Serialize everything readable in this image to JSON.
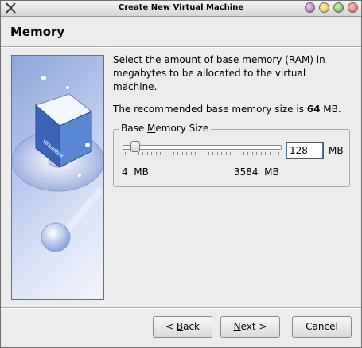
{
  "window": {
    "title": "Create New Virtual Machine"
  },
  "page": {
    "title": "Memory"
  },
  "description": "Select the amount of base memory (RAM) in megabytes to be allocated to the virtual machine.",
  "recommendation": {
    "prefix": "The recommended base memory size is ",
    "value": "64",
    "suffix": " MB."
  },
  "memory_group": {
    "title_before": "Base ",
    "title_mnemonic": "M",
    "title_after": "emory Size",
    "value": "128",
    "unit": "MB",
    "min_label": "4  MB",
    "max_label": "3584  MB",
    "slider_fraction": 0.035
  },
  "buttons": {
    "back_prefix": "< ",
    "back_mnemonic": "B",
    "back_rest": "ack",
    "next_mnemonic": "N",
    "next_rest": "ext >",
    "cancel": "Cancel"
  },
  "icons": {
    "side_art": "virtualbox-logo-icon"
  }
}
